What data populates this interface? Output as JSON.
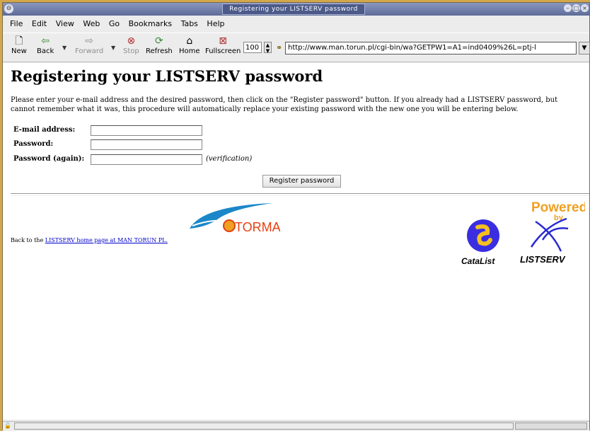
{
  "window": {
    "title": "Registering your LISTSERV password"
  },
  "menu": [
    "File",
    "Edit",
    "View",
    "Web",
    "Go",
    "Bookmarks",
    "Tabs",
    "Help"
  ],
  "toolbar": {
    "new": "New",
    "back": "Back",
    "forward": "Forward",
    "stop": "Stop",
    "refresh": "Refresh",
    "home": "Home",
    "fullscreen": "Fullscreen",
    "zoom": "100",
    "url": "http://www.man.torun.pl/cgi-bin/wa?GETPW1=A1=ind0409%26L=ptj-l"
  },
  "page": {
    "heading": "Registering your LISTSERV password",
    "intro": "Please enter your e-mail address and the desired password, then click on the \"Register password\" button. If you already had a LISTSERV password, but cannot remember what it was, this procedure will automatically replace your existing password with the new one you will be entering below.",
    "email_label": "E-mail address:",
    "password_label": "Password:",
    "password_again_label": "Password (again):",
    "verification": "(verification)",
    "register_button": "Register password",
    "back_prefix": "Back to the ",
    "back_link": "LISTSERV home page at MAN TORUN PL.",
    "torman_logo": "TORMAN",
    "catalist_logo": "CataList",
    "powered_logo_top": "Powered",
    "powered_logo_by": "by",
    "powered_logo_name": "LISTSERV"
  }
}
